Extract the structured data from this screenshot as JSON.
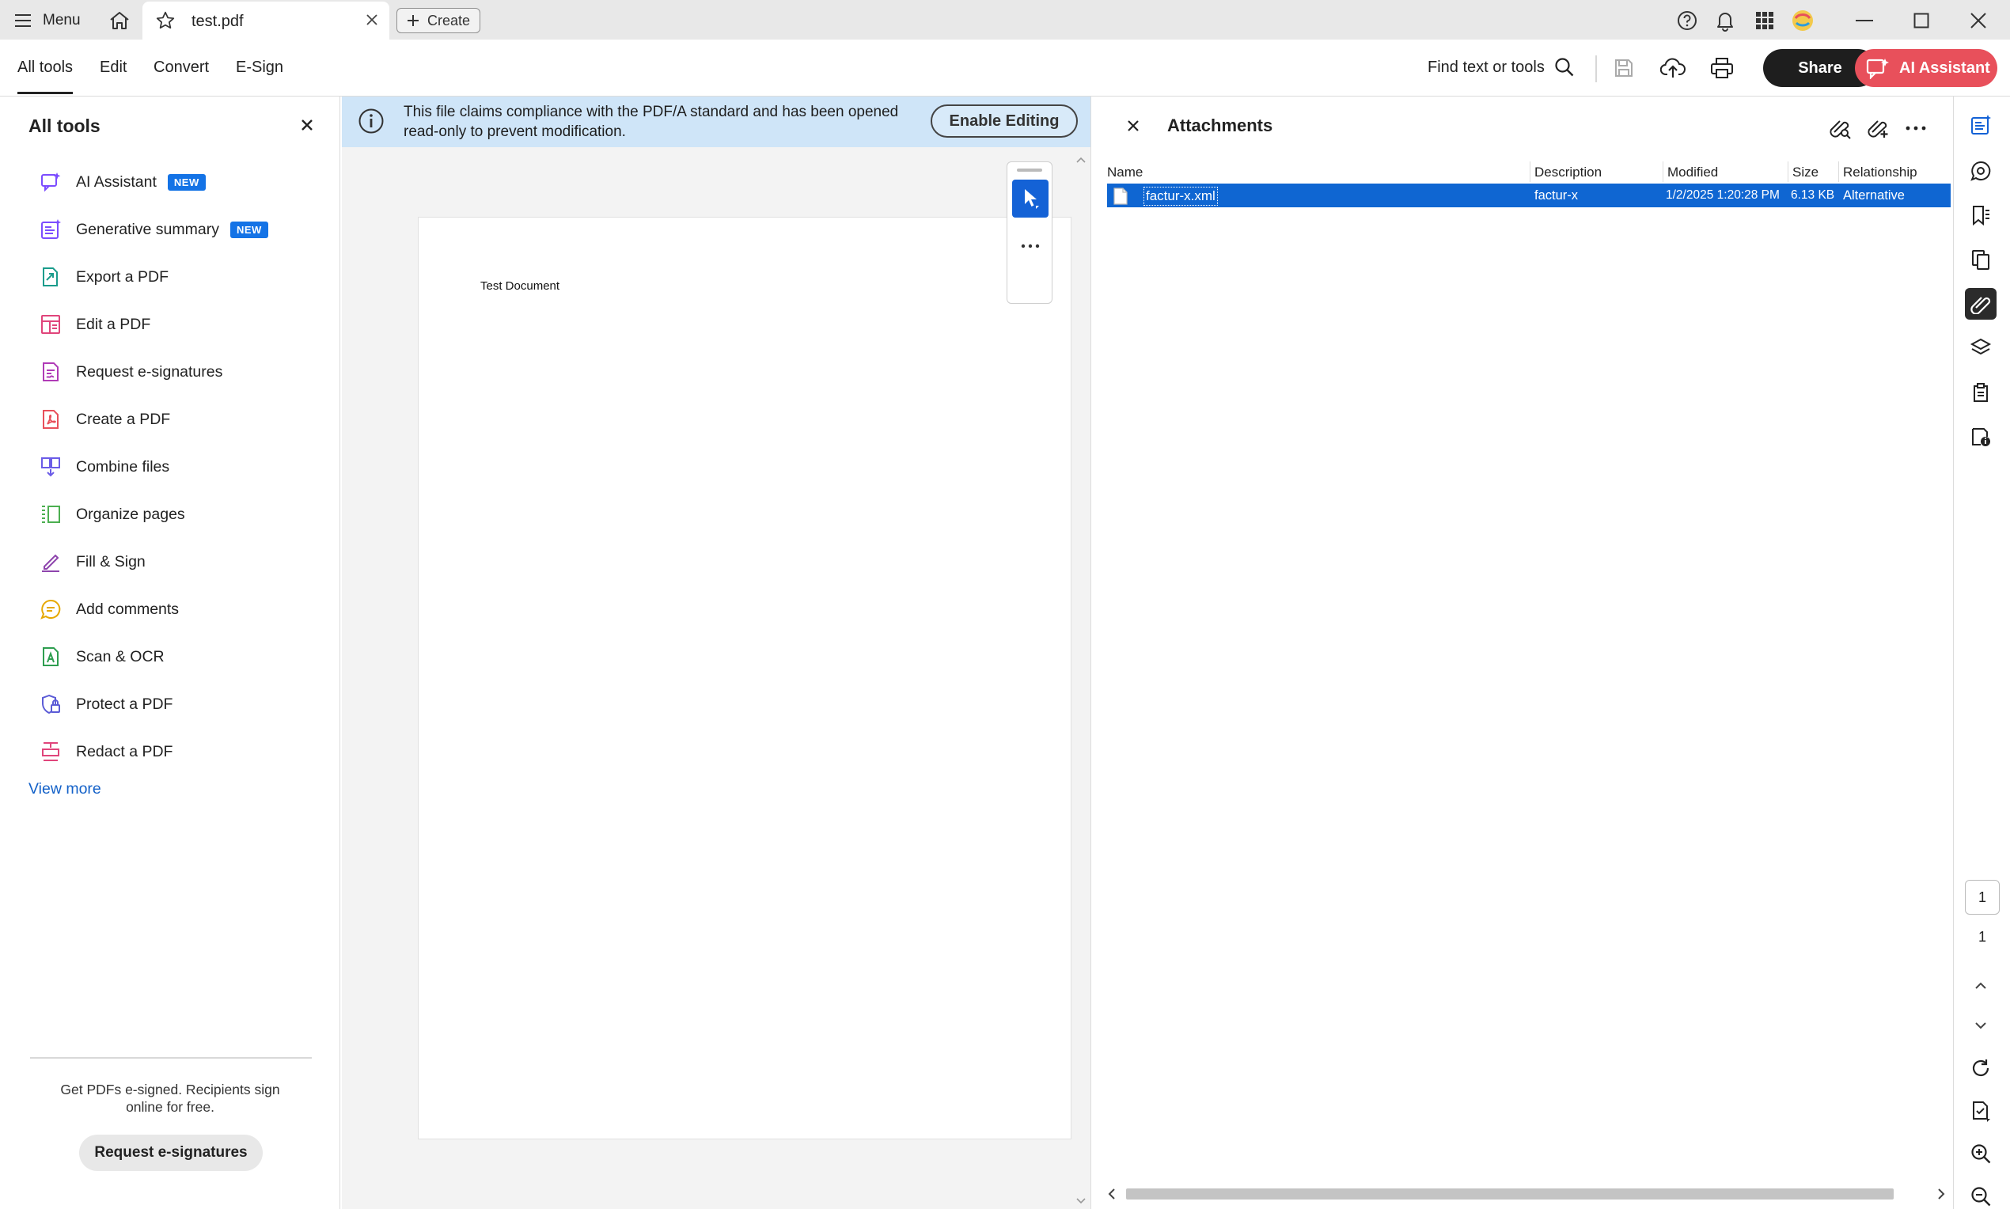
{
  "titlebar": {
    "menu_label": "Menu",
    "tab_title": "test.pdf",
    "create_label": "Create"
  },
  "toolbar": {
    "tabs": [
      {
        "label": "All tools"
      },
      {
        "label": "Edit"
      },
      {
        "label": "Convert"
      },
      {
        "label": "E-Sign"
      }
    ],
    "find_label": "Find text or tools",
    "share_label": "Share",
    "ai_label": "AI Assistant"
  },
  "left_panel": {
    "title": "All tools",
    "items": [
      {
        "label": "AI Assistant",
        "badge": "NEW",
        "icon": "ai-assistant-icon",
        "color": "#7c4dff"
      },
      {
        "label": "Generative summary",
        "badge": "NEW",
        "icon": "generative-summary-icon",
        "color": "#7c4dff"
      },
      {
        "label": "Export a PDF",
        "icon": "export-pdf-icon",
        "color": "#1a9c8c"
      },
      {
        "label": "Edit a PDF",
        "icon": "edit-pdf-icon",
        "color": "#e0457b"
      },
      {
        "label": "Request e-signatures",
        "icon": "request-esign-icon",
        "color": "#b03bb7"
      },
      {
        "label": "Create a PDF",
        "icon": "create-pdf-icon",
        "color": "#e8505b"
      },
      {
        "label": "Combine files",
        "icon": "combine-files-icon",
        "color": "#6b5ce7"
      },
      {
        "label": "Organize pages",
        "icon": "organize-pages-icon",
        "color": "#4caf50"
      },
      {
        "label": "Fill & Sign",
        "icon": "fill-sign-icon",
        "color": "#8e44ad"
      },
      {
        "label": "Add comments",
        "icon": "add-comments-icon",
        "color": "#e6a800"
      },
      {
        "label": "Scan & OCR",
        "icon": "scan-ocr-icon",
        "color": "#2e9e50"
      },
      {
        "label": "Protect a PDF",
        "icon": "protect-pdf-icon",
        "color": "#5b5bd6"
      },
      {
        "label": "Redact a PDF",
        "icon": "redact-pdf-icon",
        "color": "#e0457b"
      }
    ],
    "view_more": "View more",
    "promo_text": "Get PDFs e-signed. Recipients sign online for free.",
    "promo_button": "Request e-signatures"
  },
  "banner": {
    "text": "This file claims compliance with the PDF/A standard and has been opened read-only to prevent modification.",
    "button": "Enable Editing"
  },
  "document": {
    "text": "Test Document"
  },
  "attachments": {
    "title": "Attachments",
    "columns": [
      "Name",
      "Description",
      "Modified",
      "Size",
      "Relationship"
    ],
    "rows": [
      {
        "name": "factur-x.xml",
        "description": "factur-x",
        "modified": "1/2/2025 1:20:28 PM",
        "size": "6.13 KB",
        "relationship": "Alternative"
      }
    ]
  },
  "rail": {
    "current_page": "1",
    "total_pages": "1"
  },
  "colors": {
    "accent": "#0f66d2",
    "ai_button": "#e8505b",
    "banner": "#cfe5f8"
  }
}
